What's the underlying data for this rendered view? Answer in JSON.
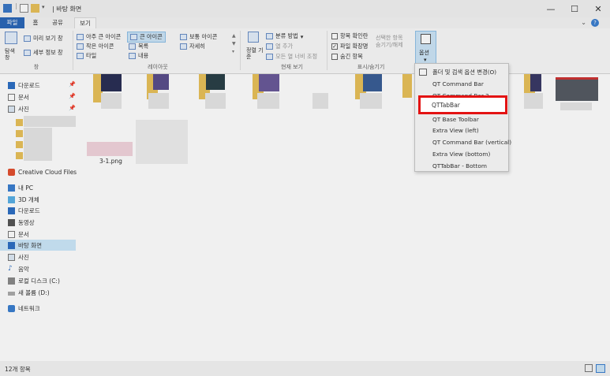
{
  "window": {
    "title": "| 바탕 화면",
    "minimize": "—",
    "maximize": "☐",
    "close": "✕"
  },
  "tabs": {
    "file": "파일",
    "home": "홈",
    "share": "공유",
    "view": "보기"
  },
  "ribbon": {
    "panes": {
      "nav_pane": "탐색 창",
      "preview_pane": "미리 보기 창",
      "details_pane": "세부 정보 창",
      "label": "창"
    },
    "layout": {
      "items": [
        "아주 큰 아이콘",
        "큰 아이콘",
        "보통 아이콘",
        "작은 아이콘",
        "목록",
        "자세히",
        "타일",
        "내용"
      ],
      "label": "레이아웃"
    },
    "current_view": {
      "sort_by": "정렬 기준",
      "group_by": "분류 방법",
      "add_columns": "열 추가",
      "size_all_columns": "모든 열 너비 조정",
      "label": "현재 보기"
    },
    "show_hide": {
      "item_checkboxes": "항목 확인란",
      "file_extensions": "파일 확장명",
      "hidden_items": "숨긴 항목",
      "hide_selected": "선택한 항목 숨기기/해제",
      "label": "표시/숨기기"
    },
    "options": "옵션"
  },
  "sidebar": {
    "quick": [
      {
        "label": "다운로드",
        "icon": "download-icon"
      },
      {
        "label": "문서",
        "icon": "document-icon"
      },
      {
        "label": "사진",
        "icon": "picture-icon"
      }
    ],
    "creative_cloud": "Creative Cloud Files",
    "this_pc": "내 PC",
    "pc_items": [
      {
        "label": "3D 개체",
        "icon": "cube-icon"
      },
      {
        "label": "다운로드",
        "icon": "download-icon"
      },
      {
        "label": "동영상",
        "icon": "video-icon"
      },
      {
        "label": "문서",
        "icon": "document-icon"
      },
      {
        "label": "바탕 화면",
        "icon": "desktop-icon"
      },
      {
        "label": "사진",
        "icon": "picture-icon"
      },
      {
        "label": "음악",
        "icon": "music-icon"
      },
      {
        "label": "로컬 디스크 (C:)",
        "icon": "drive-icon"
      },
      {
        "label": "새 볼륨 (D:)",
        "icon": "drive-icon"
      }
    ],
    "network": "네트워크"
  },
  "content": {
    "file_name": "3-1.png"
  },
  "status": {
    "count": "12개 항목"
  },
  "options_menu": {
    "items": [
      "폴더 및 검색 옵션 변경(O)",
      "QT Command Bar",
      "QT Command Bar 2",
      "QTTabBar",
      "QT Base Toolbar",
      "Extra View (left)",
      "QT Command Bar (vertical)",
      "Extra View (bottom)",
      "QTTabBar - Bottom"
    ],
    "highlighted": "QTTabBar",
    "highlight_color": "#e31313"
  }
}
